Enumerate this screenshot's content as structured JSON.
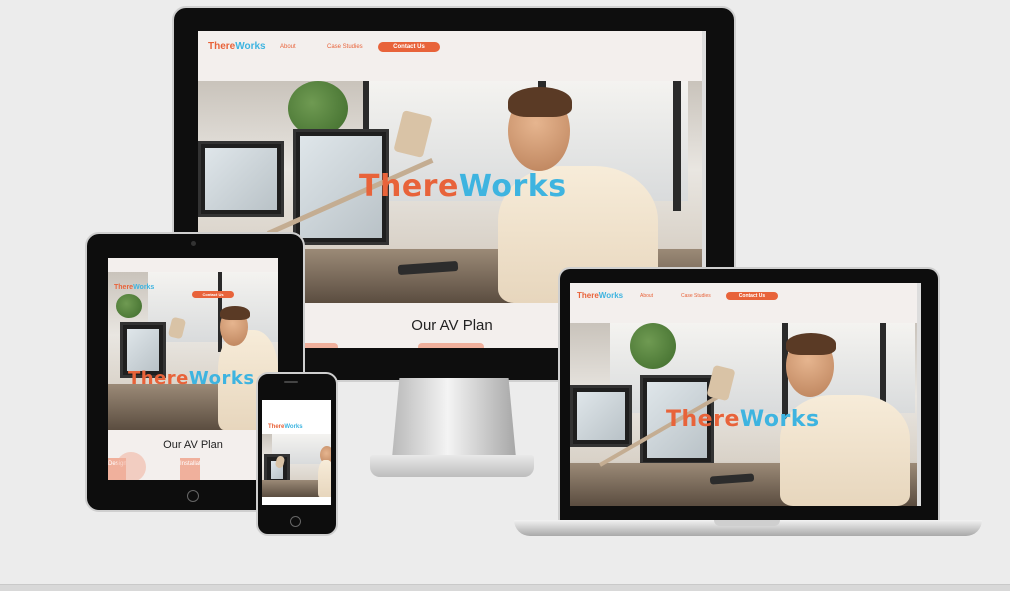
{
  "site": {
    "logo_part1": "There",
    "logo_part2": "Works",
    "nav": {
      "about": "About",
      "case_studies": "Case Studies",
      "contact": "Contact Us"
    },
    "hero_part1": "There",
    "hero_part2": "Works",
    "section_title": "Our AV Plan",
    "tablet_card_left": "Design",
    "tablet_card_right": "Installat"
  },
  "colors": {
    "brand_orange": "#e8633a",
    "brand_blue": "#3eb4e0",
    "page_bg": "#f3efed",
    "backdrop": "#ececec"
  }
}
